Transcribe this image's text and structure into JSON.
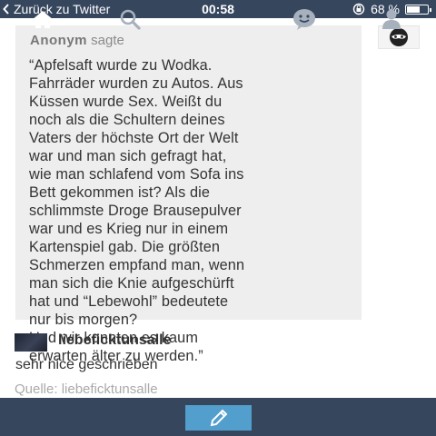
{
  "status_bar": {
    "back_label": "Zurück zu Twitter",
    "time": "00:58",
    "battery_percent": "68 %",
    "battery_level": 0.68
  },
  "post": {
    "asker": "Anonym",
    "asked_label": "sagte",
    "question": "“Apfelsaft wurde zu Wodka.\nFahrräder wurden zu Autos. Aus\nKüssen wurde Sex. Weißt du\nnoch als die Schultern deines\nVaters der höchste Ort der Welt\nwar und man sich gefragt hat,\nwie man schlafend vom Sofa ins\nBett gekommen ist? Als die\nschlimmste Droge Brausepulver\nwar und es Krieg nur in einem\nKartenspiel gab. Die größten\nSchmerzen empfand man, wenn\nman sich die Knie aufgeschürft\nhat und “Lebewohl” bedeutete\nnur bis morgen?\nUnd wir konnten es kaum\nerwarten älter zu werden.”",
    "reply_user": "liebefickt­unsalle",
    "reply_text": "sehr nice geschrieben",
    "source": "Quelle: liebefickt­unsalle"
  },
  "tab_bar": {
    "items": [
      "home-icon",
      "search-icon",
      "compose-icon",
      "activity-icon",
      "account-icon"
    ],
    "active_color": "#529ecc",
    "bar_color": "#36465d"
  }
}
